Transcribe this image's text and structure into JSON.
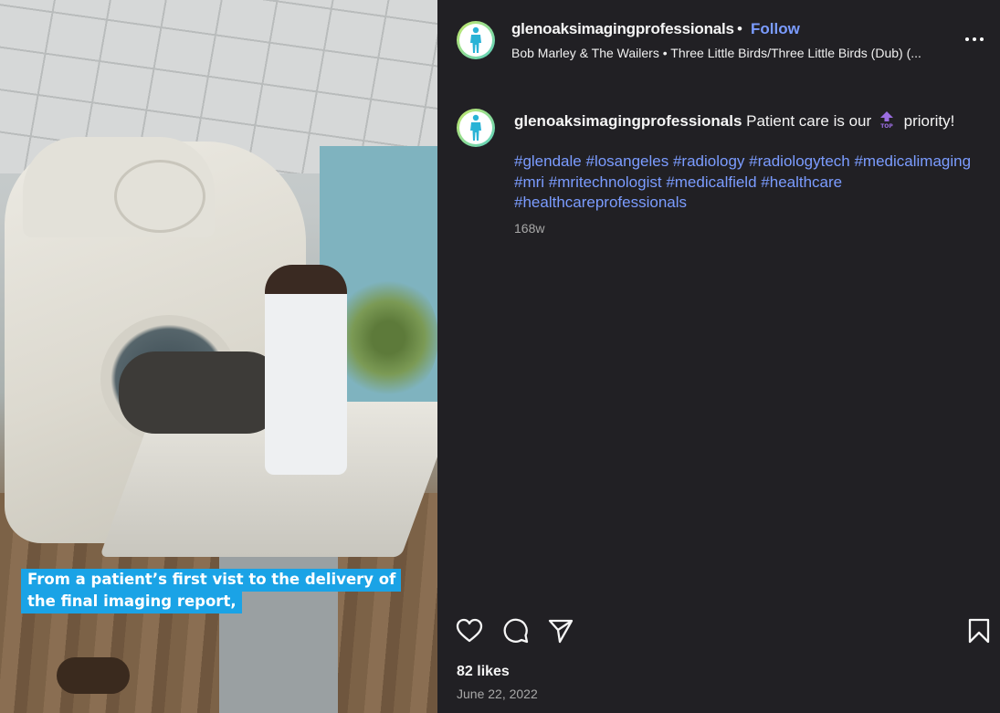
{
  "post": {
    "media": {
      "overlay_line1": "From a patient’s first vist to the delivery of",
      "overlay_line2": "the final imaging report,",
      "overlay_color": "#1aa3e6"
    },
    "header": {
      "username": "glenoaksimagingprofessionals",
      "separator": "•",
      "follow_label": "Follow",
      "music": "Bob Marley & The Wailers • Three Little Birds/Three Little Birds (Dub) (...",
      "more_icon": "more-horizontal-icon"
    },
    "caption": {
      "username": "glenoaksimagingprofessionals",
      "text_before": "Patient care is our",
      "emoji": "top-arrow-icon",
      "text_after": "priority!",
      "hashtags": [
        "#glendale",
        "#losangeles",
        "#radiology",
        "#radiologytech",
        "#medicalimaging",
        "#mri",
        "#mritechnologist",
        "#medicalfield",
        "#healthcare",
        "#healthcareprofessionals"
      ],
      "age": "168w"
    },
    "actions": {
      "like_icon": "heart-icon",
      "comment_icon": "comment-icon",
      "share_icon": "share-icon",
      "save_icon": "bookmark-icon"
    },
    "likes": "82 likes",
    "date": "June 22, 2022"
  },
  "colors": {
    "panel_bg": "#212024",
    "link": "#7b9cff",
    "muted": "#a8a8a8"
  }
}
